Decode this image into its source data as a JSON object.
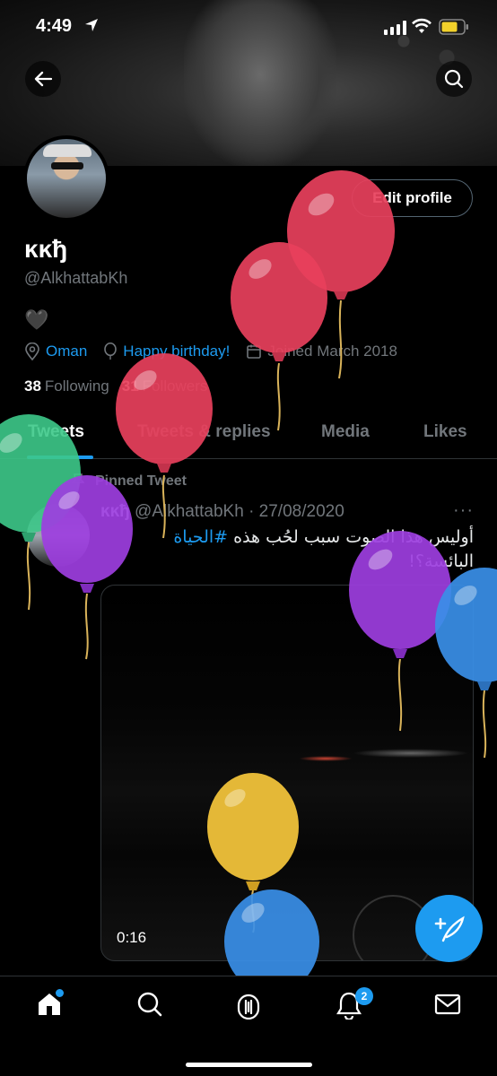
{
  "status_bar": {
    "time": "4:49"
  },
  "profile": {
    "edit_label": "Edit profile",
    "display_name": "ĸĸђ",
    "handle": "@AlkhattabKh",
    "bio": "🖤",
    "location": "Oman",
    "birthday": "Happy birthday!",
    "joined": "Joined March 2018",
    "following_count": "38",
    "following_label": "Following",
    "followers_count": "31",
    "followers_label": "Followers"
  },
  "tabs": [
    {
      "label": "Tweets",
      "active": true
    },
    {
      "label": "Tweets & replies",
      "active": false
    },
    {
      "label": "Media",
      "active": false
    },
    {
      "label": "Likes",
      "active": false
    }
  ],
  "pinned_tweet": {
    "pinned_label": "Pinned Tweet",
    "author_name": "ĸĸђ",
    "author_handle": "@AlkhattabKh",
    "separator": "·",
    "date": "27/08/2020",
    "text_line1": "أوليس هذا الصوت سبب لحُب هذه",
    "hashtag": "#الحياة",
    "text_line2": "البائسة؟!",
    "video_duration": "0:16"
  },
  "bottom_nav": {
    "notifications_badge": "2"
  },
  "colors": {
    "accent": "#1d9bf0",
    "muted": "#71767b",
    "background": "#000000"
  },
  "icons": [
    "back-arrow-icon",
    "search-icon",
    "location-icon",
    "balloon-icon",
    "calendar-icon",
    "pin-icon",
    "more-icon",
    "compose-icon",
    "home-icon",
    "spaces-icon",
    "bell-icon",
    "mail-icon"
  ]
}
